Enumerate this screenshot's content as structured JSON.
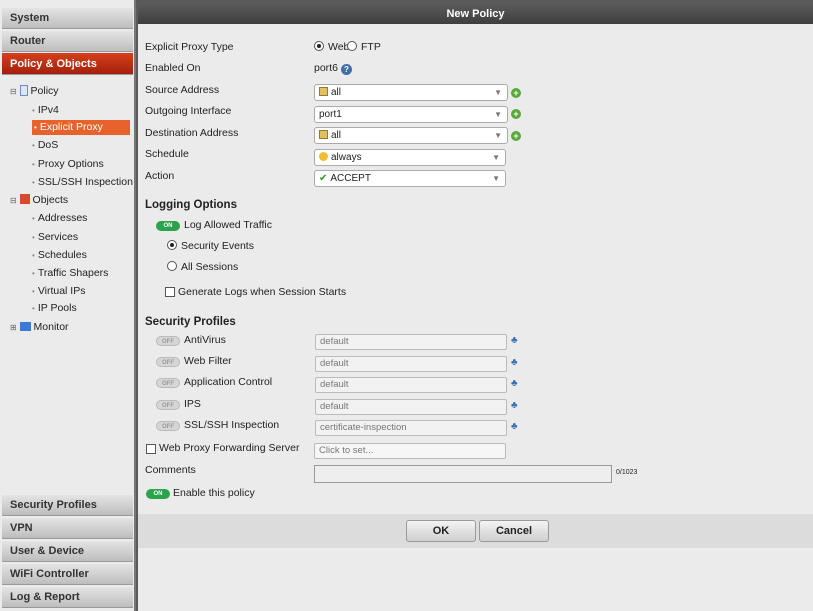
{
  "sidebar": {
    "top": [
      "System",
      "Router",
      "Policy & Objects"
    ],
    "bottom": [
      "Security Profiles",
      "VPN",
      "User & Device",
      "WiFi Controller",
      "Log & Report"
    ],
    "tree": {
      "policy": "Policy",
      "policy_items": [
        "IPv4",
        "Explicit Proxy",
        "DoS",
        "Proxy Options",
        "SSL/SSH Inspection"
      ],
      "objects": "Objects",
      "object_items": [
        "Addresses",
        "Services",
        "Schedules",
        "Traffic Shapers",
        "Virtual IPs",
        "IP Pools"
      ],
      "monitor": "Monitor"
    }
  },
  "dialog": {
    "title": "New Policy",
    "proxy_type_label": "Explicit Proxy Type",
    "proxy_web": "Web",
    "proxy_ftp": "FTP",
    "enabled_on_label": "Enabled On",
    "enabled_on": "port6",
    "source_label": "Source Address",
    "source": "all",
    "outgoing_label": "Outgoing Interface",
    "outgoing": "port1",
    "dest_label": "Destination Address",
    "dest": "all",
    "schedule_label": "Schedule",
    "schedule": "always",
    "action_label": "Action",
    "action": "ACCEPT",
    "logging_title": "Logging Options",
    "log_allowed": "Log Allowed Traffic",
    "log_toggle": "ON",
    "security_events": "Security Events",
    "all_sessions": "All Sessions",
    "gen_logs": "Generate Logs when Session Starts",
    "profiles_title": "Security Profiles",
    "profiles": [
      {
        "name": "AntiVirus",
        "state": "OFF",
        "value": "default"
      },
      {
        "name": "Web Filter",
        "state": "OFF",
        "value": "default"
      },
      {
        "name": "Application Control",
        "state": "OFF",
        "value": "default"
      },
      {
        "name": "IPS",
        "state": "OFF",
        "value": "default"
      },
      {
        "name": "SSL/SSH Inspection",
        "state": "OFF",
        "value": "certificate-inspection"
      }
    ],
    "fwd_server": "Web Proxy Forwarding Server",
    "fwd_placeholder": "Click to set...",
    "comments_label": "Comments",
    "comments_count": "0/1023",
    "enable_toggle": "ON",
    "enable_label": "Enable this policy",
    "ok": "OK",
    "cancel": "Cancel"
  },
  "colors": {
    "accent": "#c8361a",
    "on": "#2aa34a"
  }
}
